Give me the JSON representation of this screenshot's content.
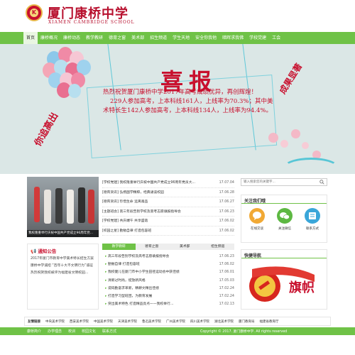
{
  "header": {
    "logo_letter": "K",
    "title": "厦门康桥中学",
    "subtitle": "XIAMEN CAMBRIDGE SCHOOL"
  },
  "nav": {
    "items": [
      "首页",
      "康桥概况",
      "康桥动态",
      "教学教研",
      "德育之窗",
      "美术部",
      "招生频道",
      "学生天地",
      "安全你我他",
      "暗晖求我佛",
      "学校党建",
      "工会"
    ]
  },
  "banner": {
    "headline": "喜报",
    "lines": [
      "热烈祝贺厦门康桥中学2017年高考成绩优异，再创辉煌！",
      "229人参加高考，上本科线161人，上线率为70.3%；其中美术特长生142人参加高考，上本科线134人，上线率为94.4%。"
    ],
    "left_slogan": "你追高出",
    "right_slogan": "成果显著"
  },
  "photo": {
    "caption": "我校隆重举行庆祝中国共产党成立96周年党..."
  },
  "news": [
    {
      "title": "[学校党建] 我校隆重举行庆祝中国共产党成立96周年党员大...",
      "date": "17.07.04"
    },
    {
      "title": "[德育资讯] 弘扬国学精粹，经典诵读校园",
      "date": "17.06.28"
    },
    {
      "title": "[德育资讯] 珍惜生命 远离毒品",
      "date": "17.06.27"
    },
    {
      "title": "[主题班会] 高三年段告别学校及高考志愿填报指导会",
      "date": "17.06.23"
    },
    {
      "title": "[学校党建] 共庆端午 共享盛谐",
      "date": "17.06.02"
    },
    {
      "title": "[校园之星] 勤勉自律 打造包容班",
      "date": "17.06.02"
    }
  ],
  "notice": {
    "title": "通知公告",
    "body": "2017年厦门市教育中学美术特长招生方案 康桥中学诚招 “百年十大不文明行为”诚征 热烈祝贺我校被评为福建省文明校园..."
  },
  "tabs": [
    "教学教研",
    "德育之窗",
    "美术部",
    "招生频道"
  ],
  "tab_list": [
    {
      "title": "高三年段告别学校及高考志愿填报指导会",
      "date": "17.06.23"
    },
    {
      "title": "勤勉自律 打造包容班",
      "date": "17.06.02"
    },
    {
      "title": "我校健儿在厦门市中小学生田径运动会中获佳绩",
      "date": "17.06.01"
    },
    {
      "title": "清新过时尚，绽放新风格",
      "date": "17.05.03"
    },
    {
      "title": "说码勤奋求革新，精耕文精出佳绩",
      "date": "17.02.24"
    },
    {
      "title": "打造学习型班团，为教育发展",
      "date": "17.02.24"
    },
    {
      "title": "突出美术特色 打造精品亮点——我校举行...",
      "date": "17.02.13"
    }
  ],
  "search": {
    "placeholder": "输入搜索您的关键字..."
  },
  "follow": {
    "title": "关注我们哦",
    "items": [
      "在线交谈",
      "关注微信",
      "联系方式"
    ]
  },
  "quick": {
    "title": "快捷导航",
    "image_text": "旗帜"
  },
  "links": {
    "label": "友情链接",
    "items": [
      "中央美术学院",
      "西安美术学院",
      "中国美术学院",
      "天津美术学院",
      "鲁迅美术学院",
      "广州美术学院",
      "四川美术学院",
      "湖北美术学院",
      "厦门教育局",
      "福建省教育厅"
    ]
  },
  "footer": {
    "left_items": [
      "康桥简介",
      "办学理念",
      "校训",
      "校园文化",
      "联系方式"
    ],
    "copyright": "Copyright © 2017. 厦门康桥中学. All rights reserved"
  },
  "colors": {
    "brand_green": "#6fc247",
    "brand_red": "#c8102e",
    "banner_bg": "#dbe7e6"
  }
}
